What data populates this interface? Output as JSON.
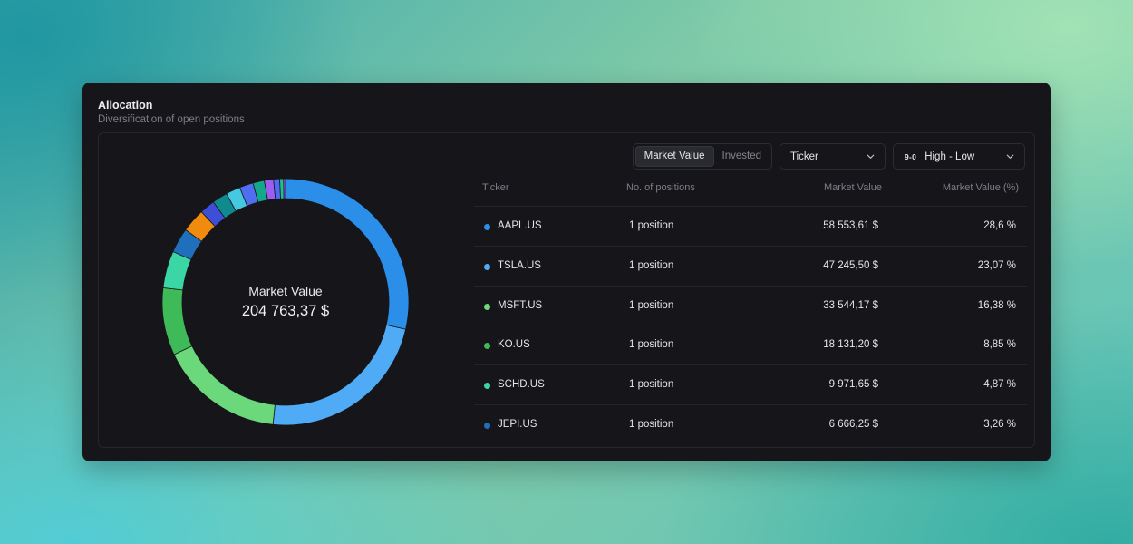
{
  "card": {
    "title": "Allocation",
    "subtitle": "Diversification of open positions"
  },
  "center": {
    "label": "Market Value",
    "value": "204 763,37 $"
  },
  "controls": {
    "segments": [
      "Market Value",
      "Invested"
    ],
    "active_segment": "Market Value",
    "ticker_select": "Ticker",
    "sort_icon": "9-0",
    "sort_select": "High - Low"
  },
  "table": {
    "headers": {
      "ticker": "Ticker",
      "positions": "No. of positions",
      "value": "Market Value",
      "pct": "Market Value (%)"
    },
    "rows": [
      {
        "ticker": "AAPL.US",
        "positions": "1 position",
        "value": "58 553,61 $",
        "pct": "28,6 %",
        "color": "#2b8ee8"
      },
      {
        "ticker": "TSLA.US",
        "positions": "1 position",
        "value": "47 245,50 $",
        "pct": "23,07 %",
        "color": "#4fabf5"
      },
      {
        "ticker": "MSFT.US",
        "positions": "1 position",
        "value": "33 544,17 $",
        "pct": "16,38 %",
        "color": "#6bd87b"
      },
      {
        "ticker": "KO.US",
        "positions": "1 position",
        "value": "18 131,20 $",
        "pct": "8,85 %",
        "color": "#3fba58"
      },
      {
        "ticker": "SCHD.US",
        "positions": "1 position",
        "value": "9 971,65 $",
        "pct": "4,87 %",
        "color": "#3ad6a4"
      },
      {
        "ticker": "JEPI.US",
        "positions": "1 position",
        "value": "6 666,25 $",
        "pct": "3,26 %",
        "color": "#1f6fbd"
      }
    ]
  },
  "chart_data": {
    "type": "pie",
    "values": [
      28.6,
      23.07,
      16.38,
      8.85,
      4.87,
      3.26,
      3.1,
      2.0,
      2.0,
      1.9,
      1.8,
      1.5,
      1.2,
      0.8,
      0.5,
      0.26
    ],
    "colors": [
      "#2b8ee8",
      "#4fabf5",
      "#6bd87b",
      "#3fba58",
      "#3ad6a4",
      "#1f6fbd",
      "#f08b0e",
      "#3d4fd6",
      "#118a8f",
      "#44c9e0",
      "#4f6ff0",
      "#13a88a",
      "#9b5ef0",
      "#4b6cf3",
      "#24bf8c",
      "#7c60f0"
    ]
  }
}
